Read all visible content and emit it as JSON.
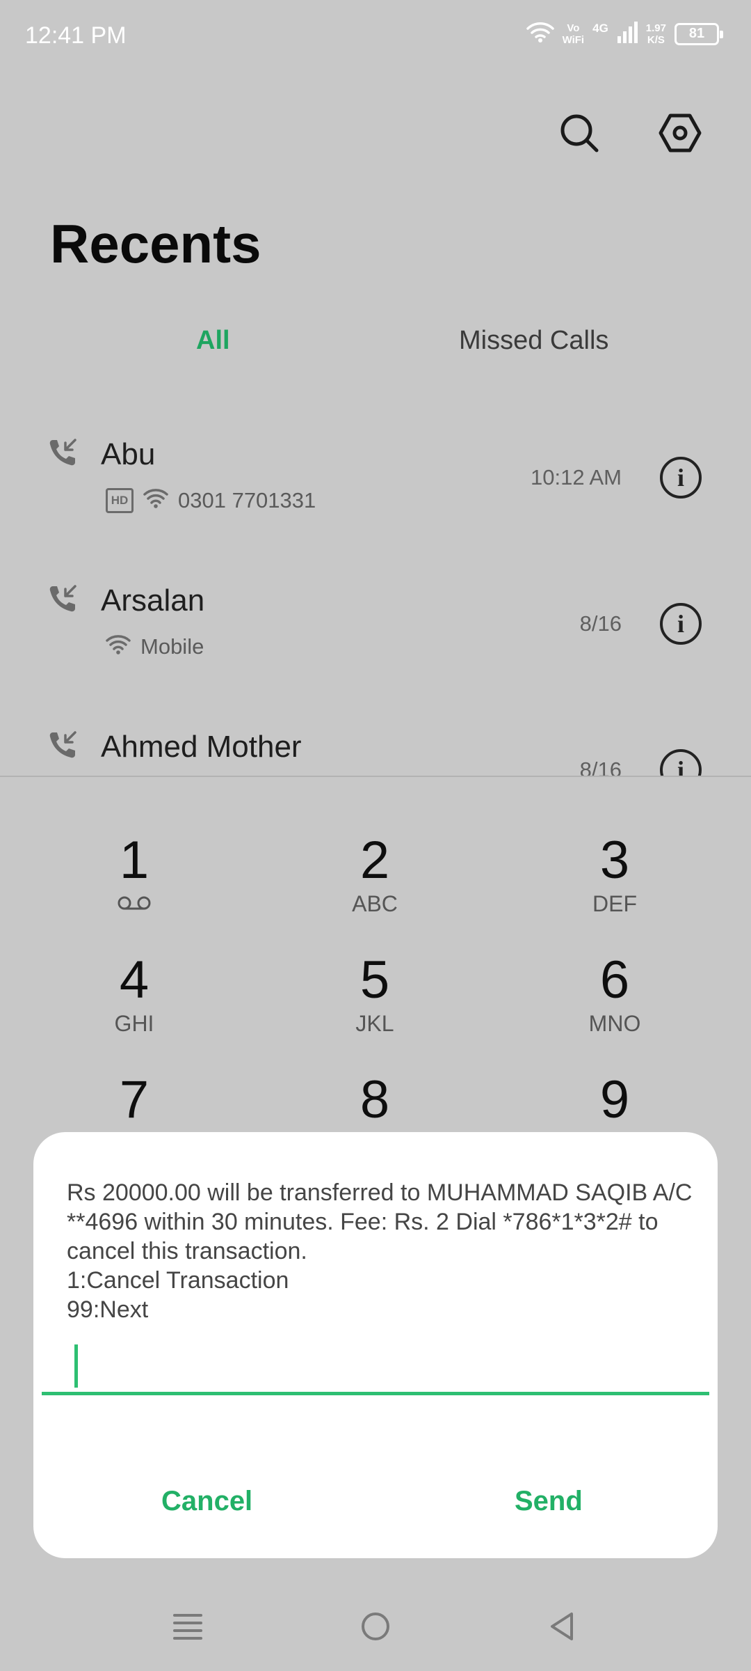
{
  "status": {
    "time": "12:41 PM",
    "volte_top": "Vo",
    "volte_bottom": "WiFi",
    "network": "4G",
    "speed_top": "1.97",
    "speed_bottom": "K/S",
    "battery": "81"
  },
  "header": {
    "title": "Recents",
    "search_icon": "search-icon",
    "settings_icon": "settings-hexagon-icon"
  },
  "tabs": {
    "all": "All",
    "missed": "Missed Calls"
  },
  "calls": [
    {
      "name": "Abu",
      "badge": "HD",
      "detail": "0301 7701331",
      "time": "10:12 AM",
      "icon": "incoming-call-icon"
    },
    {
      "name": "Arsalan",
      "detail": "Mobile",
      "time": "8/16",
      "icon": "incoming-call-icon"
    },
    {
      "name": "Ahmed Mother",
      "time": "8/16",
      "icon": "incoming-call-icon"
    }
  ],
  "dialpad": [
    {
      "num": "1",
      "sub": ""
    },
    {
      "num": "2",
      "sub": "ABC"
    },
    {
      "num": "3",
      "sub": "DEF"
    },
    {
      "num": "4",
      "sub": "GHI"
    },
    {
      "num": "5",
      "sub": "JKL"
    },
    {
      "num": "6",
      "sub": "MNO"
    },
    {
      "num": "7",
      "sub": ""
    },
    {
      "num": "8",
      "sub": ""
    },
    {
      "num": "9",
      "sub": ""
    }
  ],
  "dialog": {
    "message": "Rs 20000.00 will be transferred to MUHAMMAD SAQIB A/C **4696 within 30 minutes. Fee: Rs. 2 Dial *786*1*3*2# to cancel this transaction.\n1:Cancel Transaction\n99:Next",
    "input_value": "",
    "cancel": "Cancel",
    "send": "Send"
  },
  "colors": {
    "accent": "#1ea560",
    "backdrop": "#c8c8c8",
    "dialog": "#ffffff"
  }
}
